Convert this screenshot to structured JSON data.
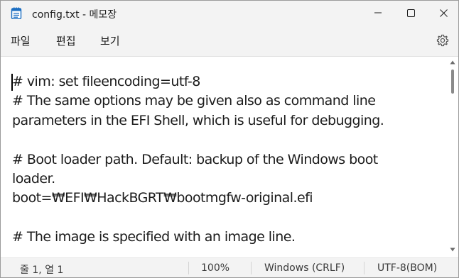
{
  "window": {
    "title": "config.txt - 메모장",
    "controls": {
      "minimize": "minimize",
      "maximize": "maximize",
      "close": "close"
    }
  },
  "menu": {
    "file": "파일",
    "edit": "편집",
    "view": "보기"
  },
  "icons": {
    "app": "notepad-icon",
    "settings": "gear-icon"
  },
  "editor": {
    "lines": [
      "# vim: set fileencoding=utf-8",
      "# The same options may be given also as command line",
      "parameters in the EFI Shell, which is useful for debugging.",
      "",
      "# Boot loader path. Default: backup of the Windows boot",
      "loader.",
      "boot=₩EFI₩HackBGRT₩bootmgfw-original.efi",
      "",
      "# The image is specified with an image line."
    ]
  },
  "status": {
    "position": "줄 1, 열 1",
    "zoom": "100%",
    "line_ending": "Windows (CRLF)",
    "encoding": "UTF-8(BOM)"
  },
  "colors": {
    "chrome": "#f3f3f3",
    "editor_bg": "#ffffff",
    "text": "#1b1b1b",
    "icon_blue": "#0f6cbd"
  }
}
